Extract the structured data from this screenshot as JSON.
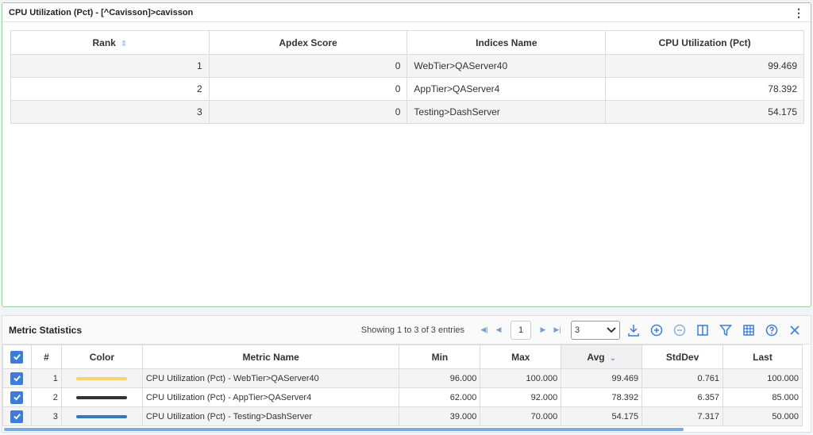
{
  "top_panel": {
    "title": "CPU Utilization (Pct) - [^Cavisson]>cavisson",
    "columns": [
      "Rank",
      "Apdex Score",
      "Indices Name",
      "CPU Utilization (Pct)"
    ],
    "rows": [
      {
        "rank": "1",
        "apdex": "0",
        "name": "WebTier>QAServer40",
        "cpu": "99.469"
      },
      {
        "rank": "2",
        "apdex": "0",
        "name": "AppTier>QAServer4",
        "cpu": "78.392"
      },
      {
        "rank": "3",
        "apdex": "0",
        "name": "Testing>DashServer",
        "cpu": "54.175"
      }
    ]
  },
  "bottom_panel": {
    "title": "Metric Statistics",
    "showing": "Showing 1 to 3 of 3 entries",
    "page": "1",
    "rows_per_page": "3",
    "columns": [
      "#",
      "Color",
      "Metric Name",
      "Min",
      "Max",
      "Avg",
      "StdDev",
      "Last"
    ],
    "rows": [
      {
        "idx": "1",
        "color": "#f5d56a",
        "name": "CPU Utilization (Pct) - WebTier>QAServer40",
        "min": "96.000",
        "max": "100.000",
        "avg": "99.469",
        "std": "0.761",
        "last": "100.000"
      },
      {
        "idx": "2",
        "color": "#333333",
        "name": "CPU Utilization (Pct) - AppTier>QAServer4",
        "min": "62.000",
        "max": "92.000",
        "avg": "78.392",
        "std": "6.357",
        "last": "85.000"
      },
      {
        "idx": "3",
        "color": "#3a77b8",
        "name": "CPU Utilization (Pct) - Testing>DashServer",
        "min": "39.000",
        "max": "70.000",
        "avg": "54.175",
        "std": "7.317",
        "last": "50.000"
      }
    ]
  },
  "colors": {
    "accent": "#3b7dd8",
    "panel_border": "#8fd19e"
  }
}
